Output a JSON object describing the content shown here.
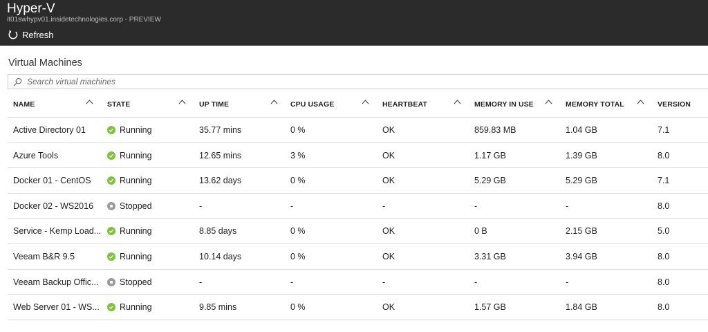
{
  "app": {
    "title": "Hyper-V",
    "server": "it01swhypv01.insidetechnologies.corp",
    "separator": " - ",
    "badge": "PREVIEW"
  },
  "toolbar": {
    "refresh_label": "Refresh",
    "refresh_icon": "refresh-icon"
  },
  "section": {
    "title": "Virtual Machines"
  },
  "search": {
    "placeholder": "Search virtual machines",
    "value": ""
  },
  "colors": {
    "header_bg": "#2b2b2b",
    "running": "#7ec13a",
    "stopped": "#9b9b9b"
  },
  "columns": [
    {
      "key": "name",
      "label": "NAME"
    },
    {
      "key": "state",
      "label": "STATE"
    },
    {
      "key": "uptime",
      "label": "UP TIME"
    },
    {
      "key": "cpu",
      "label": "CPU USAGE"
    },
    {
      "key": "heartbeat",
      "label": "HEARTBEAT"
    },
    {
      "key": "mem_use",
      "label": "MEMORY IN USE"
    },
    {
      "key": "mem_total",
      "label": "MEMORY TOTAL"
    },
    {
      "key": "version",
      "label": "VERSION"
    }
  ],
  "rows": [
    {
      "name": "Active Directory 01",
      "state": "Running",
      "uptime": "35.77 mins",
      "cpu": "0 %",
      "heartbeat": "OK",
      "mem_use": "859.83 MB",
      "mem_total": "1.04 GB",
      "version": "7.1"
    },
    {
      "name": "Azure Tools",
      "state": "Running",
      "uptime": "12.65 mins",
      "cpu": "3 %",
      "heartbeat": "OK",
      "mem_use": "1.17 GB",
      "mem_total": "1.39 GB",
      "version": "8.0"
    },
    {
      "name": "Docker 01 - CentOS",
      "state": "Running",
      "uptime": "13.62 days",
      "cpu": "0 %",
      "heartbeat": "OK",
      "mem_use": "5.29 GB",
      "mem_total": "5.29 GB",
      "version": "7.1"
    },
    {
      "name": "Docker 02 - WS2016",
      "state": "Stopped",
      "uptime": "-",
      "cpu": "-",
      "heartbeat": "-",
      "mem_use": "-",
      "mem_total": "-",
      "version": "8.0"
    },
    {
      "name": "Service - Kemp Load...",
      "state": "Running",
      "uptime": "8.85 days",
      "cpu": "0 %",
      "heartbeat": "OK",
      "mem_use": "0 B",
      "mem_total": "2.15 GB",
      "version": "5.0"
    },
    {
      "name": "Veeam B&R 9.5",
      "state": "Running",
      "uptime": "10.14 days",
      "cpu": "0 %",
      "heartbeat": "OK",
      "mem_use": "3.31 GB",
      "mem_total": "3.94 GB",
      "version": "8.0"
    },
    {
      "name": "Veeam Backup Offic...",
      "state": "Stopped",
      "uptime": "-",
      "cpu": "-",
      "heartbeat": "-",
      "mem_use": "-",
      "mem_total": "-",
      "version": "8.0"
    },
    {
      "name": "Web Server 01 - WS...",
      "state": "Running",
      "uptime": "9.85 mins",
      "cpu": "0 %",
      "heartbeat": "OK",
      "mem_use": "1.57 GB",
      "mem_total": "1.84 GB",
      "version": "8.0"
    }
  ]
}
